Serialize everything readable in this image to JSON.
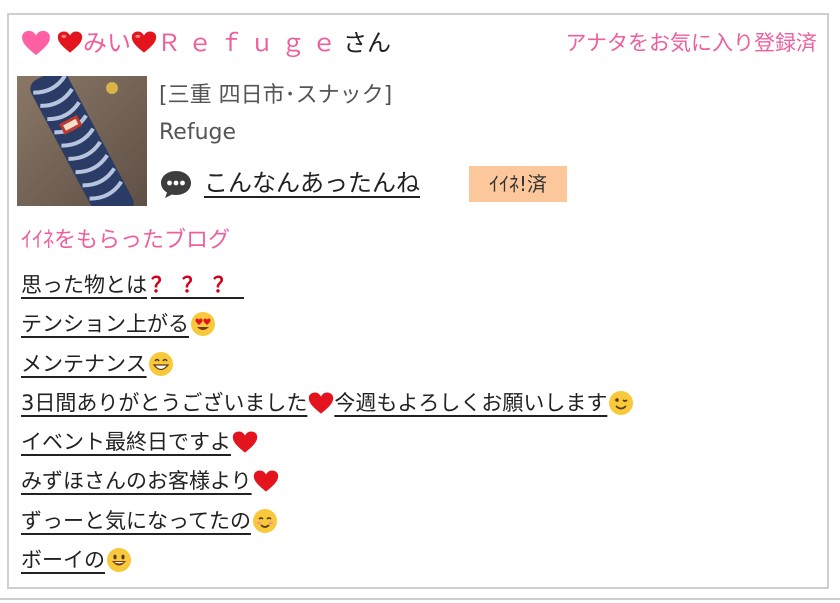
{
  "header": {
    "name_prefix": "みい",
    "name_mid": "Ｒｅｆｕｇｅ",
    "name_suffix": "さん",
    "favorite_link": "アナタをお気に入り登録済"
  },
  "profile": {
    "area": "[三重 四日市･スナック]",
    "shop": "Refuge"
  },
  "featured_blog": {
    "title": "こんなんあったんね",
    "iine_badge": "ｲｲﾈ!済"
  },
  "section": {
    "title": "ｲｲﾈをもらったブログ"
  },
  "blogs": [
    {
      "text": "思った物とは",
      "extra": "？？？",
      "emoji": "question-mark-icon"
    },
    {
      "text": "テンション上がる",
      "emoji": "heart-eyes-emoji-icon"
    },
    {
      "text": "メンテナンス",
      "emoji": "grinning-emoji-icon"
    },
    {
      "text": "3日間ありがとうございました",
      "text2": "今週もよろしくお願いします",
      "emoji": "red-heart-icon",
      "emoji2": "winking-emoji-icon"
    },
    {
      "text": "イベント最終日ですよ",
      "emoji": "red-heart-icon"
    },
    {
      "text": "みずほさんのお客様より",
      "emoji": "red-heart-icon"
    },
    {
      "text": "ずっーと気になってたの",
      "emoji": "smiling-emoji-icon"
    },
    {
      "text": "ボーイの",
      "emoji": "smiley-emoji-icon"
    }
  ],
  "colors": {
    "accent_pink": "#ee5f9d",
    "badge_orange": "#fcc79a",
    "border": "#cfcfcf"
  }
}
